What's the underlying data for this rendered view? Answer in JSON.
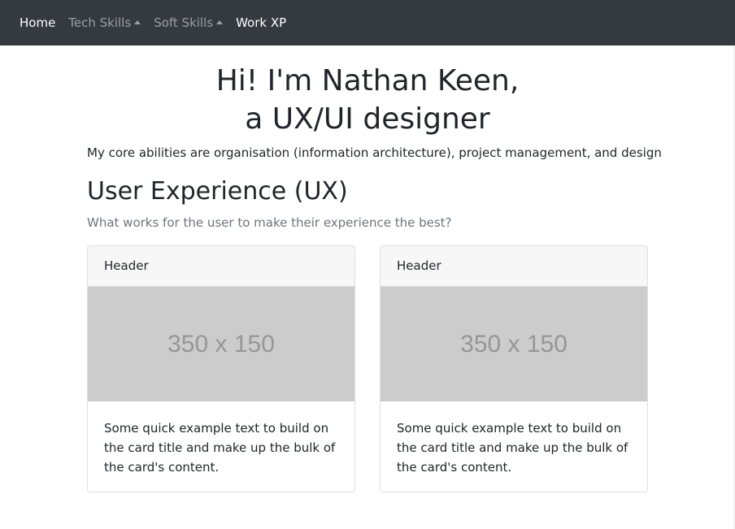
{
  "nav": {
    "home": "Home",
    "tech_skills": "Tech Skills",
    "soft_skills": "Soft Skills",
    "work_xp": "Work XP"
  },
  "hero": {
    "line1": "Hi! I'm Nathan Keen,",
    "line2": "a UX/UI designer",
    "lead": "My core abilities are organisation (information architecture), project management, and design"
  },
  "section": {
    "title": "User Experience (UX)",
    "subtitle": "What works for the user to make their experience the best?"
  },
  "cards": [
    {
      "header": "Header",
      "image_placeholder": "350 x 150",
      "text": "Some quick example text to build on the card title and make up the bulk of the card's content."
    },
    {
      "header": "Header",
      "image_placeholder": "350 x 150",
      "text": "Some quick example text to build on the card title and make up the bulk of the card's content."
    }
  ],
  "colors": {
    "navbar": "#343a40",
    "placeholder_bg": "#cccccc",
    "muted_text": "#6c757d"
  }
}
